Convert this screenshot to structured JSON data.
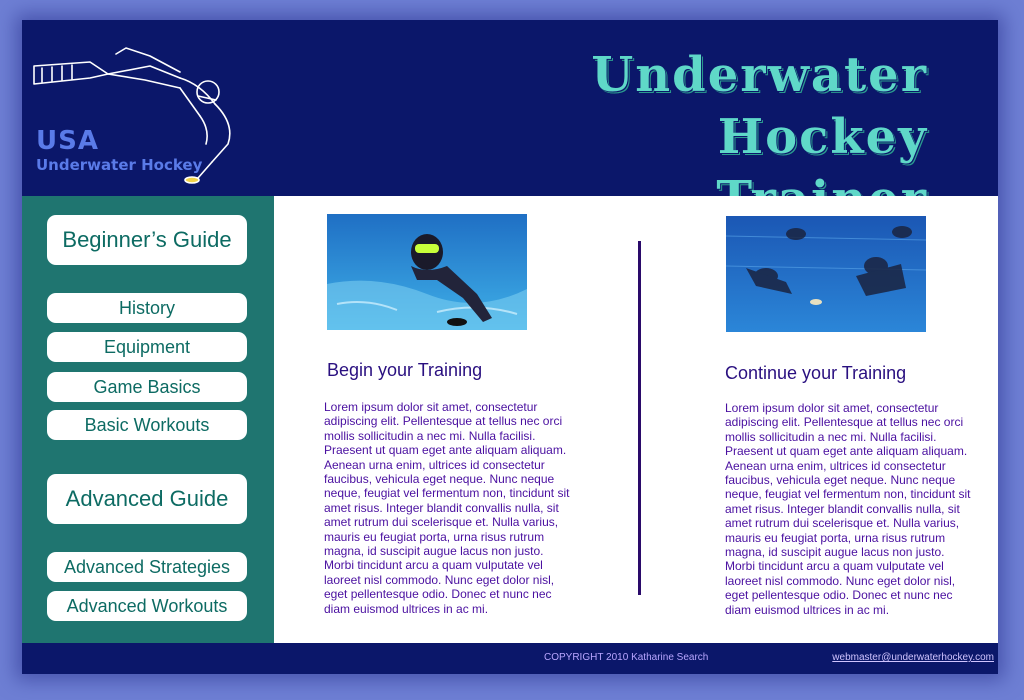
{
  "header": {
    "logo_text_1": "USA",
    "logo_text_2": "Underwater Hockey",
    "title_line_1": "Underwater Hockey",
    "title_line_2": "Trainer"
  },
  "sidebar": {
    "beginners_guide": "Beginner’s Guide",
    "items_beginner": [
      "History",
      "Equipment",
      "Game Basics",
      "Basic Workouts"
    ],
    "advanced_guide": "Advanced Guide",
    "items_advanced": [
      "Advanced Strategies",
      "Advanced Workouts"
    ]
  },
  "main": {
    "left": {
      "heading": "Begin your Training",
      "body": "Lorem ipsum dolor sit amet, consectetur adipiscing elit. Pellentesque at tellus nec orci mollis sollicitudin a nec mi. Nulla facilisi. Praesent ut quam eget ante aliquam aliquam. Aenean urna enim, ultrices id consectetur faucibus, vehicula eget neque. Nunc neque neque, feugiat vel fermentum non, tincidunt sit amet risus. Integer blandit convallis nulla, sit amet rutrum dui scelerisque et. Nulla varius, mauris eu feugiat porta, urna risus rutrum magna, id suscipit augue lacus non justo. Morbi tincidunt arcu a quam vulputate vel laoreet nisl commodo. Nunc eget dolor nisl, eget pellentesque odio. Donec et nunc nec diam euismod ultrices in ac mi."
    },
    "right": {
      "heading": "Continue your Training",
      "body": "Lorem ipsum dolor sit amet, consectetur adipiscing elit. Pellentesque at tellus nec orci mollis sollicitudin a nec mi. Nulla facilisi. Praesent ut quam eget ante aliquam aliquam. Aenean urna enim, ultrices id consectetur faucibus, vehicula eget neque. Nunc neque neque, feugiat vel fermentum non, tincidunt sit amet risus. Integer blandit convallis nulla, sit amet rutrum dui scelerisque et. Nulla varius, mauris eu feugiat porta, urna risus rutrum magna, id suscipit augue lacus non justo. Morbi tincidunt arcu a quam vulputate vel laoreet nisl commodo. Nunc eget dolor nisl, eget pellentesque odio. Donec et nunc nec diam euismod ultrices in ac mi."
    }
  },
  "footer": {
    "copyright": "COPYRIGHT 2010 Katharine Search",
    "email": "webmaster@underwaterhockey.com"
  },
  "colors": {
    "page_bg": "#6e7fd4",
    "header_bg": "#0b176a",
    "sidebar_bg": "#1f7570",
    "title_color": "#5fd8c8",
    "button_text": "#0d6b63",
    "body_text": "#4a10a0"
  }
}
